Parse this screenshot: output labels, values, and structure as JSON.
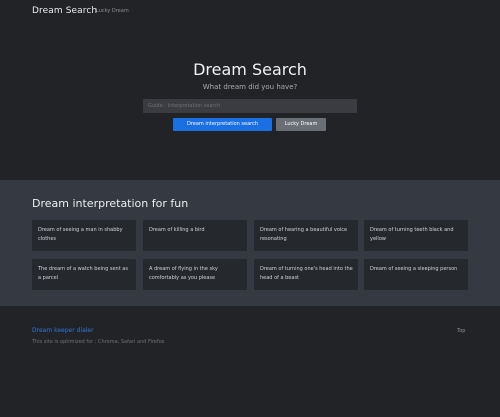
{
  "nav": {
    "brand": "Dream Search",
    "link": "Lucky Dream"
  },
  "hero": {
    "title": "Dream Search",
    "subtitle": "What dream did you have?",
    "search_placeholder": "Guide  : Interpretation search",
    "primary_button": "Dream interpretation search",
    "secondary_button": "Lucky Dream"
  },
  "section": {
    "title": "Dream interpretation for fun",
    "cards": [
      "Dream of seeing a man in shabby clothes",
      "Dream of killing a bird",
      "Dream of hearing a beautiful voice resonating",
      "Dream of turning teeth black and yellow",
      "The dream of a watch being sent as a parcel",
      "A dream of flying in the sky comfortably as you please",
      "Dream of turning one's head into the head of a beast",
      "Dream of seeing a sleeping person"
    ]
  },
  "footer": {
    "link": "Dream keeper dialer",
    "back_to_top": "Top",
    "note": "This site is optimized for : Chrome, Safari and Firefox"
  }
}
